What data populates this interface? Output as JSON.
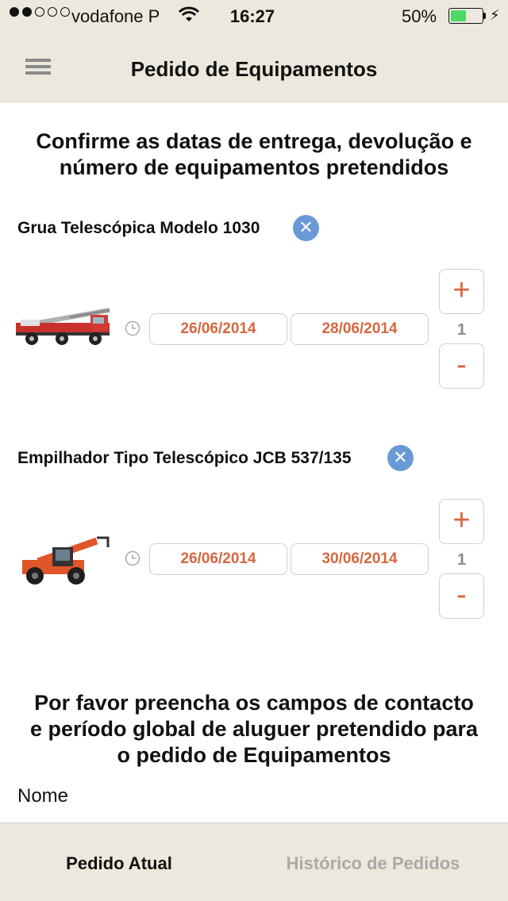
{
  "status_bar": {
    "carrier": "vodafone P",
    "time": "16:27",
    "battery": "50%",
    "battery_level": 0.5,
    "signal_bars_filled": 2,
    "signal_bars_total": 5
  },
  "nav": {
    "title": "Pedido de Equipamentos",
    "menu_icon": "hamburger-menu-icon"
  },
  "intro_heading": {
    "line1": "Confirme as datas de entrega, devolução e",
    "line2": "número de equipamentos pretendidos"
  },
  "items": [
    {
      "name": "Grua Telescópica Modelo 1030",
      "start_date": "26/06/2014",
      "end_date": "28/06/2014",
      "quantity": "1",
      "image_icon": "crane-truck-image"
    },
    {
      "name": "Empilhador Tipo Telescópico JCB 537/135",
      "start_date": "26/06/2014",
      "end_date": "30/06/2014",
      "quantity": "1",
      "image_icon": "telehandler-image"
    }
  ],
  "stepper": {
    "plus": "+",
    "minus": "-"
  },
  "contact_heading": {
    "line1": "Por favor preencha os campos de contacto",
    "line2": "e período global de aluguer pretendido para",
    "line3": "o pedido de Equipamentos"
  },
  "form": {
    "name_label": "Nome"
  },
  "tabs": [
    {
      "label": "Pedido Atual",
      "active": true
    },
    {
      "label": "Histórico de Pedidos",
      "active": false
    }
  ],
  "colors": {
    "accent": "#d6673f",
    "bar_background": "#ece8dd",
    "remove_button": "#6a9ad6",
    "inactive_tab": "#a9a9a9"
  }
}
